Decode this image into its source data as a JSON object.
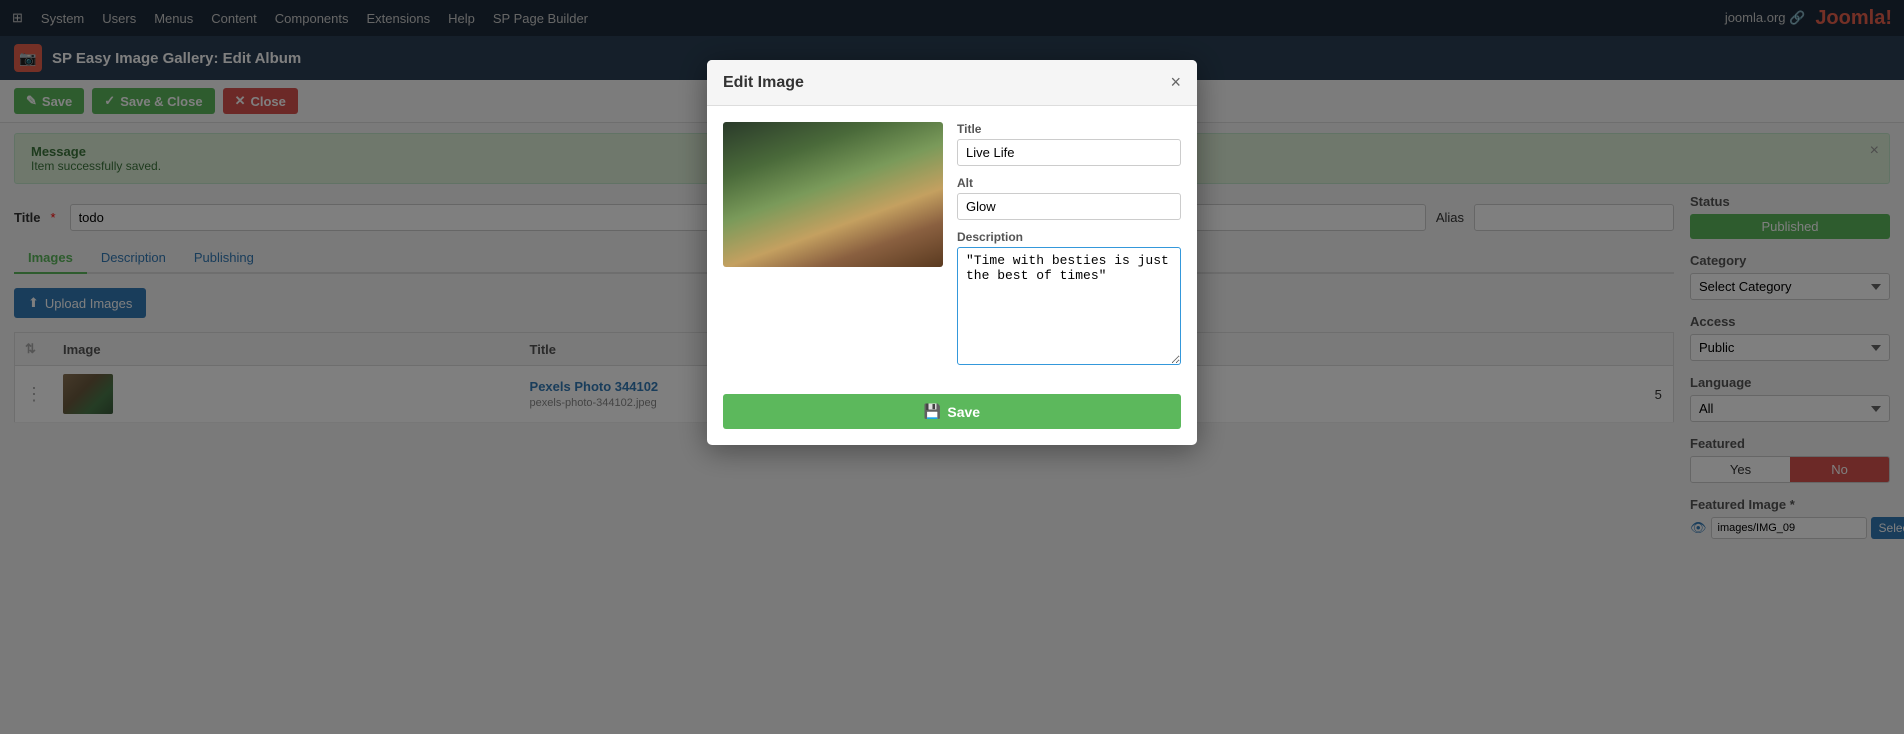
{
  "topnav": {
    "items": [
      "System",
      "Users",
      "Menus",
      "Content",
      "Components",
      "Extensions",
      "Help",
      "SP Page Builder"
    ],
    "right": "joomla.org 🔗  👤"
  },
  "header": {
    "icon": "📷",
    "title": "SP Easy Image Gallery: Edit Album"
  },
  "toolbar": {
    "save_label": "Save",
    "save_close_label": "Save & Close",
    "close_label": "Close"
  },
  "message": {
    "title": "Message",
    "body": "Item successfully saved.",
    "close_icon": "×"
  },
  "form": {
    "title_label": "Title",
    "title_value": "todo",
    "alias_label": "Alias",
    "alias_placeholder": ""
  },
  "tabs": [
    {
      "label": "Images",
      "active": true
    },
    {
      "label": "Description",
      "active": false
    },
    {
      "label": "Publishing",
      "active": false
    }
  ],
  "upload_btn": "Upload Images",
  "table": {
    "columns": [
      "",
      "Image",
      "Title",
      "",
      ""
    ],
    "rows": [
      {
        "title": "Pexels Photo 344102",
        "filename": "pexels-photo-344102.jpeg",
        "id": "5"
      }
    ]
  },
  "right_panel": {
    "status_label": "Status",
    "status_value": "Published",
    "category_label": "Category",
    "category_placeholder": "Select Category",
    "access_label": "Access",
    "access_value": "Public",
    "language_label": "Language",
    "language_value": "All",
    "featured_label": "Featured",
    "featured_yes": "Yes",
    "featured_no": "No",
    "featured_image_label": "Featured Image *",
    "featured_image_value": "images/IMG_09",
    "select_btn": "Select",
    "clear_btn": "×"
  },
  "modal": {
    "title": "Edit Image",
    "close_icon": "×",
    "title_label": "Title",
    "title_value": "Live Life",
    "alt_label": "Alt",
    "alt_value": "Glow",
    "description_label": "Description",
    "description_value": "\"Time with besties is just the best of times\"",
    "save_btn": "Save"
  }
}
